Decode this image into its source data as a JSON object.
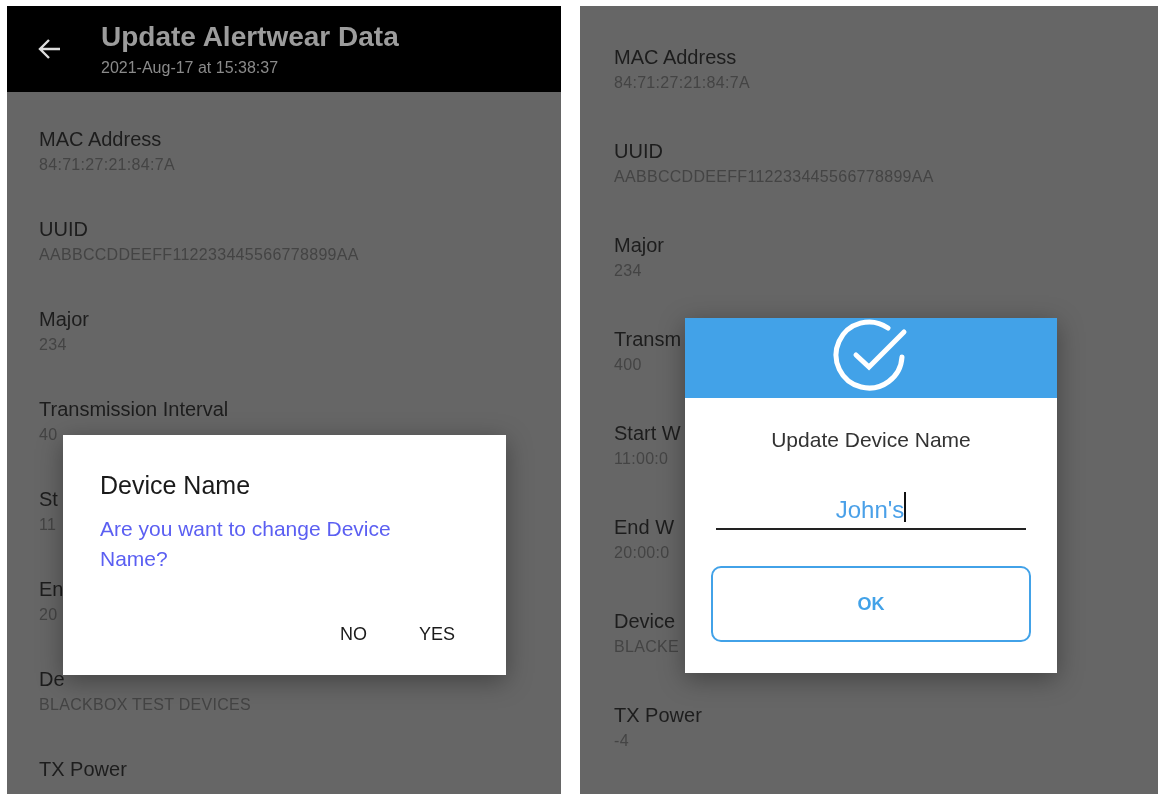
{
  "screens": [
    {
      "header": {
        "title": "Update Alertwear Data",
        "subtitle": "2021-Aug-17 at 15:38:37"
      },
      "fields": [
        {
          "label": "MAC Address",
          "value": "84:71:27:21:84:7A"
        },
        {
          "label": "UUID",
          "value": "AABBCCDDEEFF112233445566778899AA"
        },
        {
          "label": "Major",
          "value": "234"
        },
        {
          "label": "Transmission Interval",
          "value": "40"
        },
        {
          "label": "St",
          "value": "11"
        },
        {
          "label": "En",
          "value": "20"
        },
        {
          "label": "De",
          "value": "BLACKBOX TEST DEVICES"
        },
        {
          "label": "TX Power"
        }
      ],
      "dialog": {
        "kind": "confirm",
        "title": "Device Name",
        "message": "Are you want to change Device Name?",
        "buttons": [
          "NO",
          "YES"
        ]
      }
    },
    {
      "fields": [
        {
          "label": "MAC Address",
          "value": "84:71:27:21:84:7A"
        },
        {
          "label": "UUID",
          "value": "AABBCCDDEEFF112233445566778899AA"
        },
        {
          "label": "Major",
          "value": "234"
        },
        {
          "label": "Transm",
          "value": "400"
        },
        {
          "label": "Start W",
          "value": "11:00:0"
        },
        {
          "label": "End W",
          "value": "20:00:0"
        },
        {
          "label": "Device",
          "value": "BLACKE"
        },
        {
          "label": "TX Power",
          "value": "-4"
        }
      ],
      "dialog": {
        "kind": "input",
        "title": "Update Device Name",
        "value": "John's",
        "button": "OK"
      }
    }
  ]
}
